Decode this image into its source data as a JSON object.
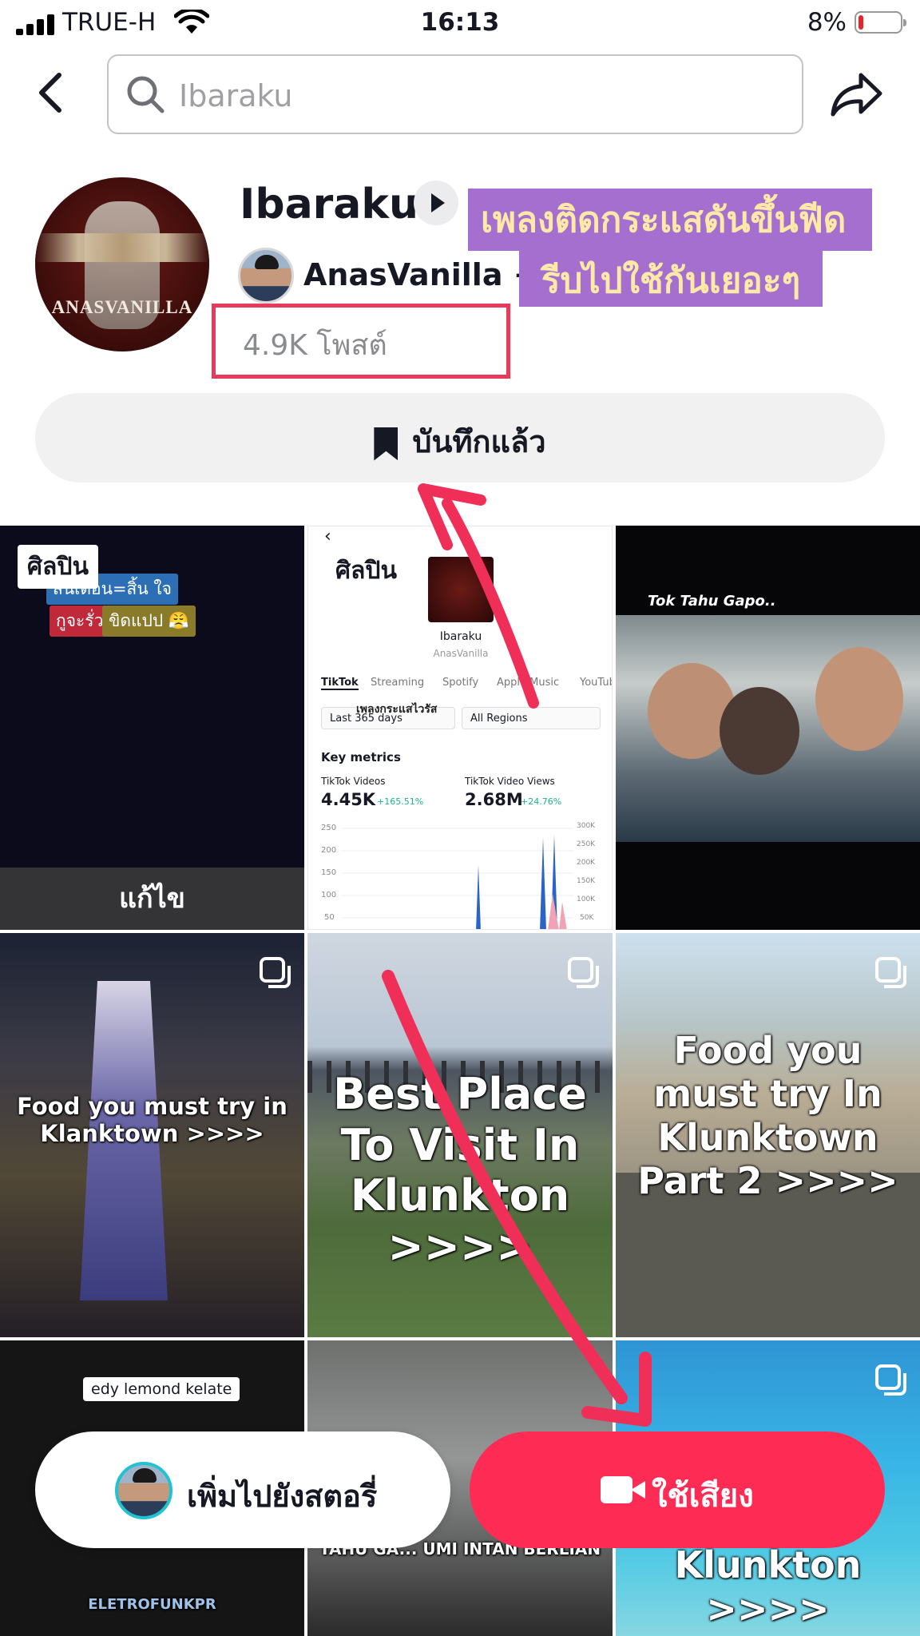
{
  "status_bar": {
    "carrier": "TRUE-H",
    "time": "16:13",
    "battery": "8%"
  },
  "search": {
    "placeholder": "Ibaraku"
  },
  "sound": {
    "title": "Ibaraku",
    "artist": "AnasVanilla +1",
    "posts": "4.9K โพสต์",
    "cover_text": "ANASVANILLA",
    "saved_label": "บันทึกแล้ว"
  },
  "promo": {
    "line1": "เพลงติดกระแสดันขึ้นฟีด",
    "line2": "รีบไปใช้กันเยอะๆ"
  },
  "grid": {
    "tile0": {
      "badge": "ศิลปิน",
      "chip1": "สนเดือน=สิ้น ใจ",
      "chip2": "กูจะรั่ว",
      "chip3": "ขิดแปป 😤",
      "edit": "แก้ไข"
    },
    "tile1": {
      "badge": "ศิลปิน",
      "name": "Ibaraku",
      "sub": "AnasVanilla",
      "tabs": [
        "TikTok",
        "Streaming",
        "Spotify",
        "Apple Music",
        "YouTube"
      ],
      "filter1": "Last 365 days",
      "filter2": "All Regions",
      "overlay": "เพลงกระแสไวรัส",
      "metrics_title": "Key metrics",
      "m1_label": "TikTok Videos",
      "m1_value": "4.45K",
      "m1_delta": "+165.51%",
      "m2_label": "TikTok Video Views",
      "m2_value": "2.68M",
      "m2_delta": "+24.76%",
      "y_left": [
        "250",
        "200",
        "150",
        "100",
        "50"
      ],
      "y_right": [
        "300K",
        "250K",
        "200K",
        "150K",
        "100K",
        "50K"
      ]
    },
    "tile2": {
      "title": "Tok Tahu Gapo.."
    },
    "tile3": {
      "caption": "Food you must try in Klanktown >>>>"
    },
    "tile4": {
      "caption": "Best Place To Visit In Klunkton >>>>"
    },
    "tile5": {
      "caption": "Food you must try In Klunktown Part 2 >>>>"
    },
    "tile6": {
      "label": "edy lemond kelate",
      "bottom": "ELETROFUNKPR"
    },
    "tile7": {
      "caption": "TAHU GA... UMI INTAN BERLIAN"
    },
    "tile8": {
      "caption": "...es In Klunkton >>>>"
    }
  },
  "actions": {
    "add_story": "เพิ่มไปยังสตอรี่",
    "use_sound": "ใช้เสียง"
  },
  "colors": {
    "accent": "#fe2c55",
    "highlight_box": "#ea3a5b",
    "promo_bg": "#a56fcf",
    "promo_text": "#ffe9a8"
  }
}
